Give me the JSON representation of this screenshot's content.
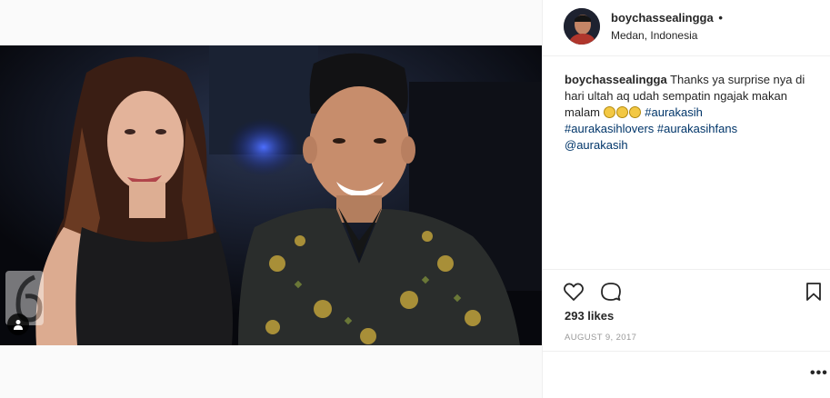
{
  "post": {
    "username": "boychassealingga",
    "follow_dot": "•",
    "location": "Medan, Indonesia",
    "caption": {
      "username": "boychassealingga",
      "text": "Thanks ya surprise nya di hari ultah aq udah sempatin ngajak makan malam",
      "hashtags": [
        "#aurakasih",
        "#aurakasihlovers",
        "#aurakasihfans"
      ],
      "mention": "@aurakasih"
    },
    "likes": "293 likes",
    "date": "AUGUST 9, 2017",
    "more_label": "•••"
  },
  "colors": {
    "link": "#003569",
    "muted": "#999999",
    "text": "#262626",
    "border": "#efefef"
  },
  "icons": {
    "like": "heart-outline-icon",
    "comment": "speech-bubble-icon",
    "save": "bookmark-icon",
    "tag": "person-tag-icon"
  }
}
